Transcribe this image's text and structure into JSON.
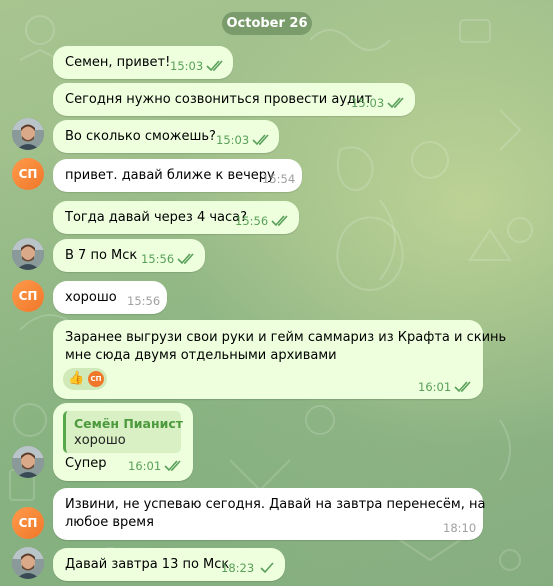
{
  "date_separator": "October 26",
  "messages": [
    {
      "text": "Семен, привет!",
      "time": "15:03"
    },
    {
      "text": "Сегодня нужно созвониться провести аудит",
      "time": "15:03"
    },
    {
      "text": "Во сколько сможешь?",
      "time": "15:03"
    },
    {
      "text": "привет. давай ближе к вечеру",
      "time": "15:54"
    },
    {
      "text": "Тогда давай через 4 часа?",
      "time": "15:56"
    },
    {
      "text": "В 7 по Мск",
      "time": "15:56"
    },
    {
      "text": "хорошо",
      "time": "15:56"
    },
    {
      "text": "Заранее выгрузи свои руки и гейм саммариз из Крафта и скинь",
      "text2": "мне сюда двумя отдельными архивами",
      "time": "16:01",
      "reaction": {
        "emoji": "👍",
        "by_initials": "СП"
      }
    },
    {
      "text": "Супер",
      "time": "16:01",
      "reply": {
        "name": "Семён Пианист",
        "text": "хорошо"
      }
    },
    {
      "text": "Извини, не успеваю сегодня. Давай на завтра перенесём, на",
      "text2": "любое время",
      "time": "18:10"
    },
    {
      "text": "Давай завтра 13 по Мск",
      "time": "18:23"
    }
  ],
  "contact": {
    "initials": "СП"
  },
  "colors": {
    "outgoing_bubble": "#eeffde",
    "incoming_bubble": "#ffffff",
    "accent_green": "#57a84a",
    "avatar_orange": "#f0772a"
  },
  "icons": {
    "read_receipt": "double-check-icon",
    "photo_avatar": "user-photo-avatar"
  }
}
